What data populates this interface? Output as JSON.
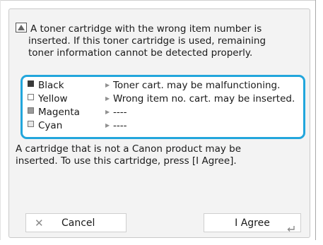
{
  "dialog": {
    "message_lines": [
      "A toner cartridge with the wrong item number is",
      "inserted. If this toner cartridge is used, remaining",
      "toner information cannot be detected properly."
    ],
    "explanation_lines": [
      "A cartridge that is not a Canon product may be",
      "inserted. To use this cartridge, press [I Agree]."
    ]
  },
  "toner_status": [
    {
      "color": "Black",
      "status": "Toner cart. may be malfunctioning.",
      "swatch": "#3a3a3a"
    },
    {
      "color": "Yellow",
      "status": "Wrong item no. cart. may be inserted.",
      "swatch": "#ffffff"
    },
    {
      "color": "Magenta",
      "status": "----",
      "swatch": "#9a9a9a"
    },
    {
      "color": "Cyan",
      "status": "----",
      "swatch": "#e6e6e6"
    }
  ],
  "buttons": {
    "cancel": "Cancel",
    "agree": "I Agree"
  },
  "colors": {
    "highlight_border": "#22a6dc",
    "panel_bg": "#f3f3f3"
  },
  "icons": {
    "message": "warning-icon",
    "cancel": "close-icon",
    "agree": "enter-icon"
  }
}
